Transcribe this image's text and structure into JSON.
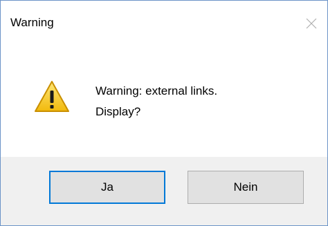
{
  "window": {
    "title": "Warning"
  },
  "icons": {
    "close": "close-icon",
    "warning": "warning-icon"
  },
  "message": {
    "line1": "Warning: external links.",
    "line2": "Display?"
  },
  "buttons": {
    "yes_label": "Ja",
    "no_label": "Nein"
  },
  "colors": {
    "border": "#6b93c7",
    "footer_bg": "#f0f0f0",
    "button_bg": "#e1e1e1",
    "focus_border": "#0078d7",
    "warning_yellow": "#f5c518"
  }
}
